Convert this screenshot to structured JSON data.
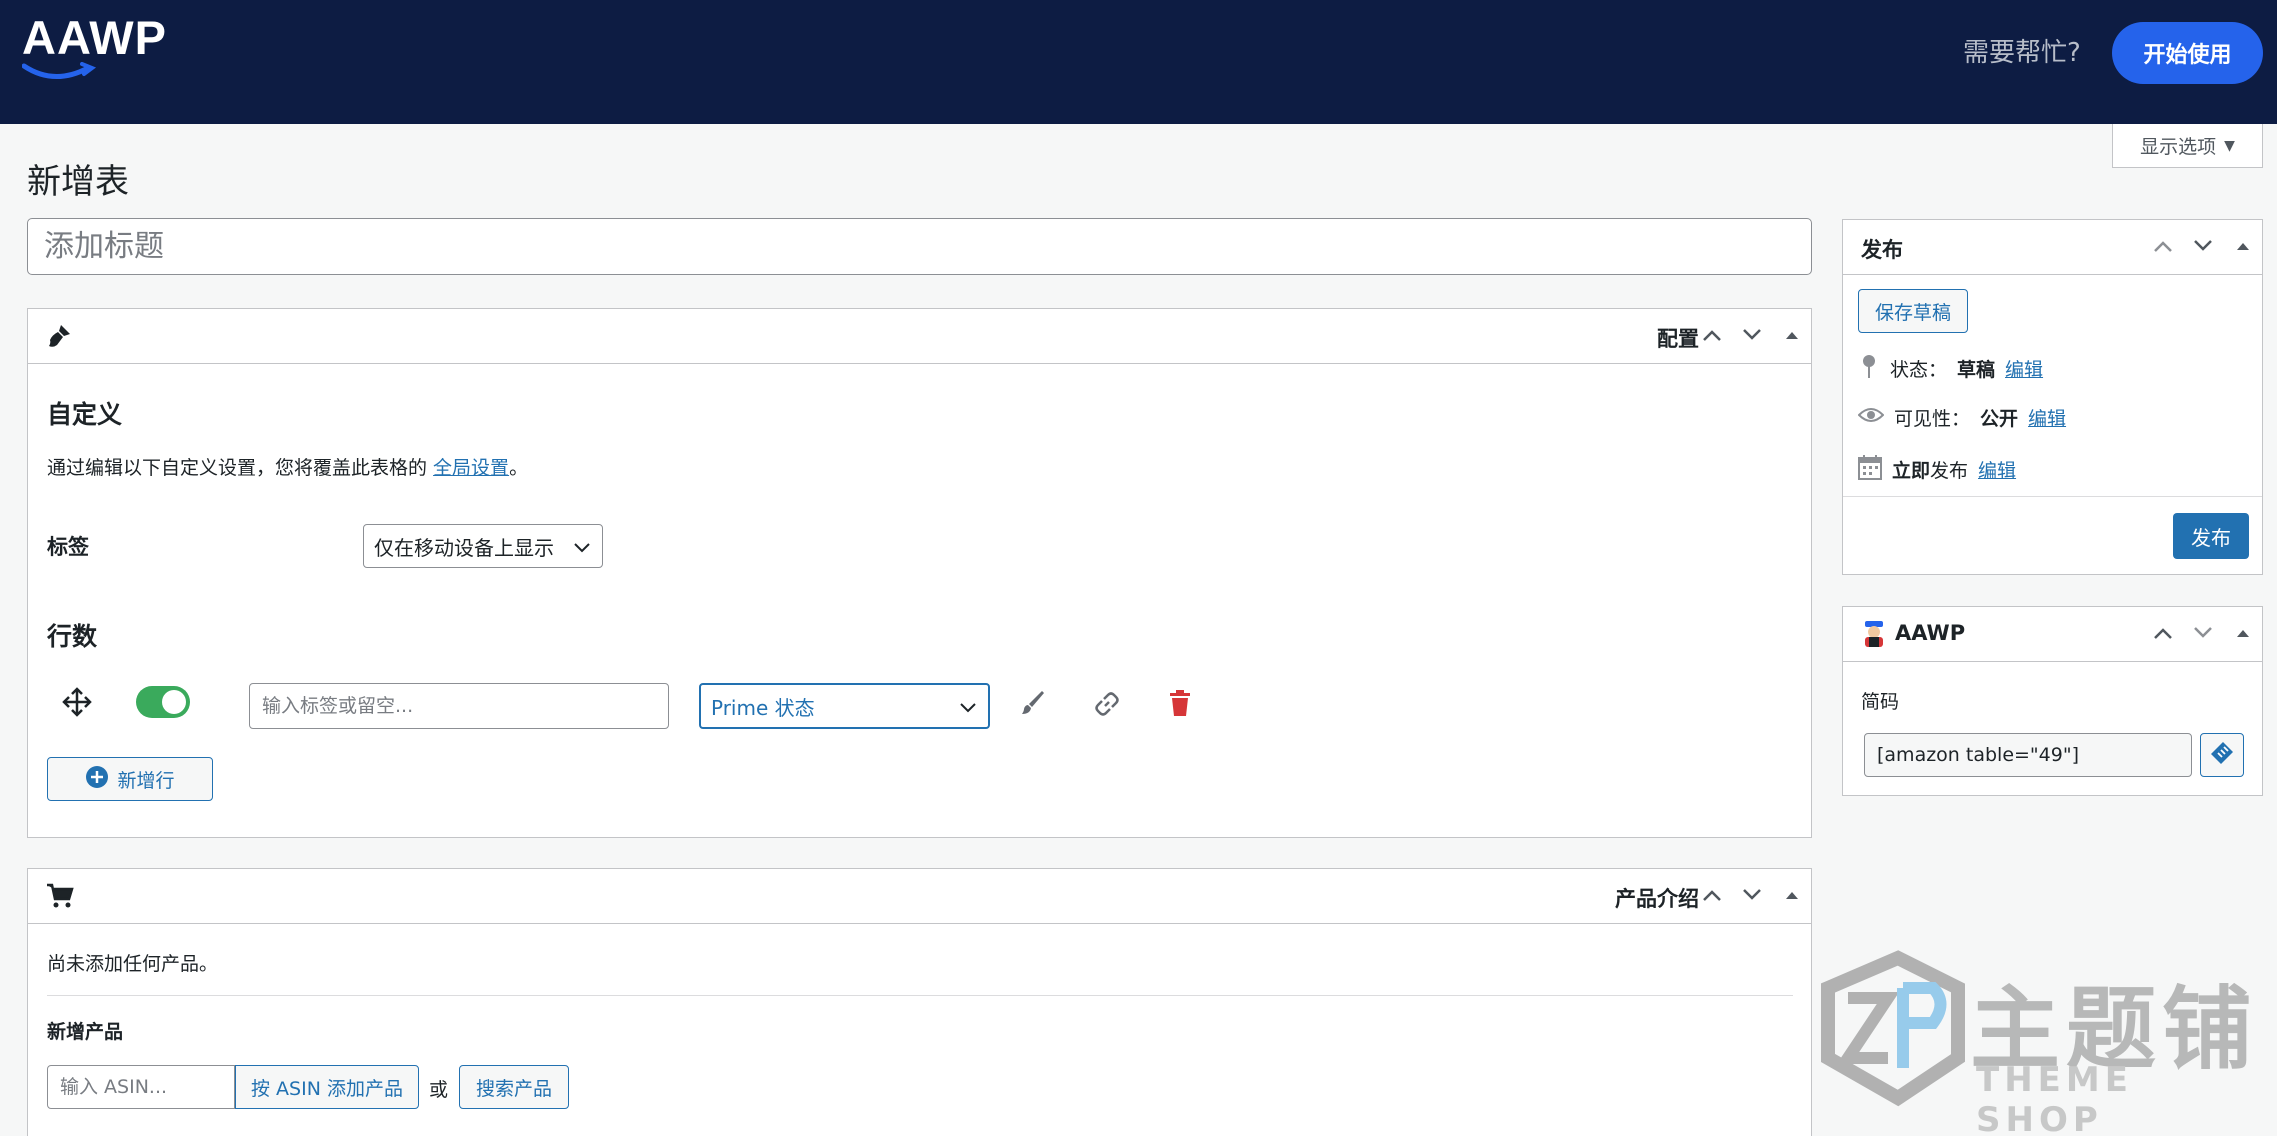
{
  "header": {
    "logo_text": "AAWP",
    "help_label": "需要帮忙?",
    "start_label": "开始使用",
    "brand_color": "#0d1c43",
    "accent_color": "#2563eb"
  },
  "screen_options": {
    "label": "显示选项",
    "icon": "caret-down-icon"
  },
  "page": {
    "title": "新增表",
    "title_placeholder": "添加标题"
  },
  "config_box": {
    "header_label": "配置",
    "header_icon": "brush-icon",
    "section_title": "自定义",
    "desc_prefix": "通过编辑以下自定义设置，您将覆盖此表格的 ",
    "desc_link": "全局设置",
    "desc_suffix": "。",
    "label_field": "标签",
    "label_select_value": "仅在移动设备上显示",
    "rows_title": "行数",
    "row": {
      "enabled": true,
      "label_placeholder": "输入标签或留空...",
      "type_value": "Prime 状态"
    },
    "add_row_label": "新增行"
  },
  "products_box": {
    "header_label": "产品介绍",
    "header_icon": "cart-icon",
    "empty_text": "尚未添加任何产品。",
    "add_title": "新增产品",
    "asin_placeholder": "输入 ASIN...",
    "add_by_asin_label": "按 ASIN 添加产品",
    "or_text": "或",
    "search_label": "搜索产品"
  },
  "publish_box": {
    "title": "发布",
    "save_draft_label": "保存草稿",
    "status_label": "状态：",
    "status_value": "草稿",
    "visibility_label": "可见性：",
    "visibility_value": "公开",
    "schedule_label": "立即",
    "schedule_suffix": "发布",
    "edit_label": "编辑",
    "publish_label": "发布"
  },
  "aawp_box": {
    "title": "AAWP",
    "shortcode_label": "简码",
    "shortcode_value": "[amazon table=\"49\"]"
  },
  "watermark": {
    "main": "主题铺",
    "sub": "THEME SHOP"
  }
}
